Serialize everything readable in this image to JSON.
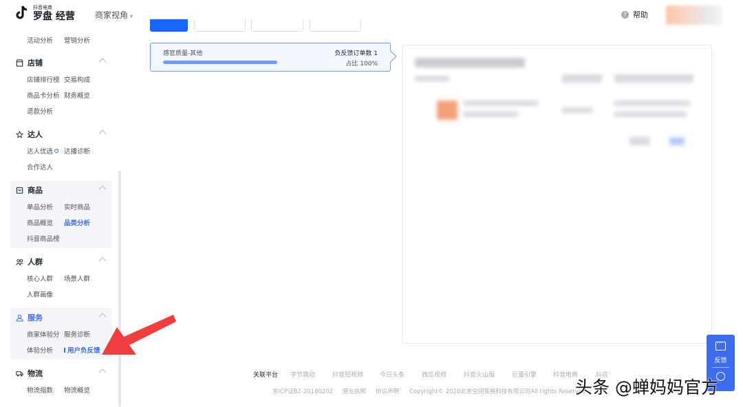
{
  "header": {
    "logo_small": "抖音电商",
    "logo_big": "罗盘 经营",
    "merchant_view": "商家视角",
    "help": "帮助"
  },
  "sidebar": {
    "top_items": [
      "活动分析",
      "营销分析"
    ],
    "sections": [
      {
        "title": "店铺",
        "icon": "shop-icon",
        "items": [
          [
            "店铺排行榜",
            "交易构成"
          ],
          [
            "商品卡分析",
            "财务概览"
          ],
          [
            "退款分析"
          ]
        ]
      },
      {
        "title": "达人",
        "icon": "star-icon",
        "items": [
          [
            "达人优选",
            "达播诊断"
          ],
          [
            "合作达人"
          ]
        ]
      },
      {
        "title": "商品",
        "icon": "bag-icon",
        "items": [
          [
            "单品分析",
            "实时商品"
          ],
          [
            "商品概览",
            "品类分析"
          ],
          [
            "抖音商品榜"
          ]
        ]
      },
      {
        "title": "人群",
        "icon": "people-icon",
        "items": [
          [
            "核心人群",
            "场景人群"
          ],
          [
            "人群画像"
          ]
        ]
      },
      {
        "title": "服务",
        "icon": "service-icon",
        "items": [
          [
            "商家体验分",
            "服务诊断"
          ],
          [
            "体验分析",
            "用户负反馈"
          ]
        ]
      },
      {
        "title": "物流",
        "icon": "truck-icon",
        "items": [
          [
            "物流指数",
            "物流概览"
          ]
        ]
      }
    ]
  },
  "card": {
    "label": "感官质量-其他",
    "count": "负反馈订单数 1",
    "ratio": "占比 100%",
    "progress": 1.0,
    "accent": "#6b9bff"
  },
  "footer": {
    "links": [
      "关联平台",
      "字节跳动",
      "抖音短视频",
      "今日头条",
      "西瓜视频",
      "抖音火山版",
      "巨量引擎",
      "抖音电商",
      "抖店"
    ],
    "copy": [
      "京ICP证B2-20180202",
      "营业执照",
      "协议声明",
      "Copyright© 2020北京空间变换科技有限公司All rights Reserved"
    ]
  },
  "feedback_button": {
    "label": "反馈"
  },
  "watermark": "头条 @蝉妈妈官方",
  "colors": {
    "primary": "#1966ff",
    "nav_active": "#3c6cf4",
    "annotation_arrow": "#f03d3d"
  }
}
